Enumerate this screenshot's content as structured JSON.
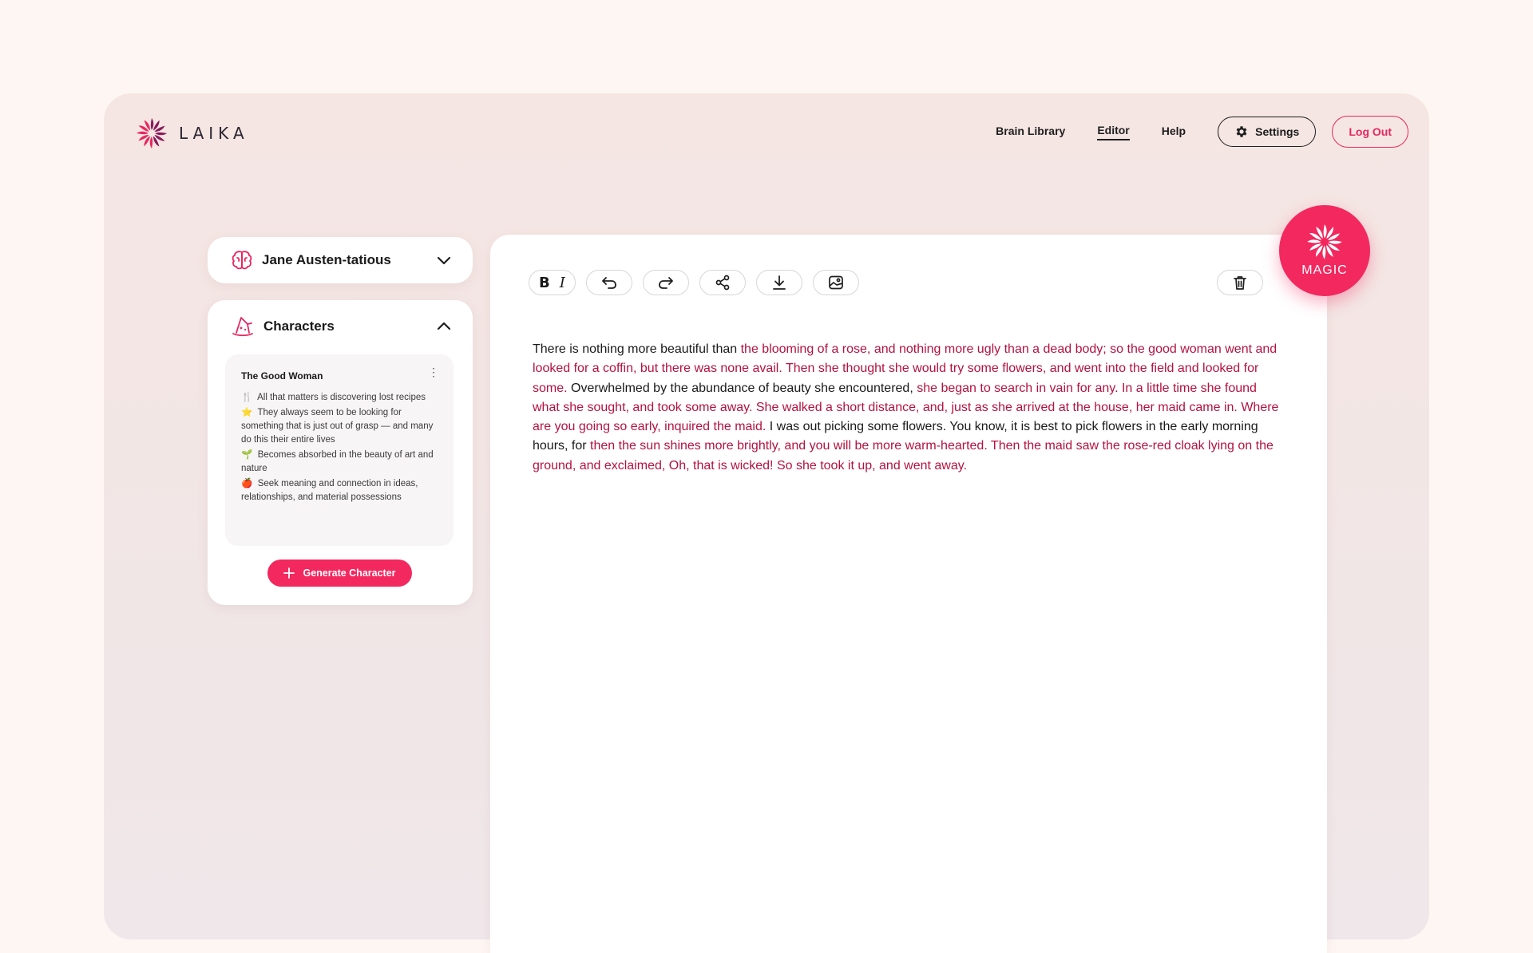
{
  "header": {
    "logo_text": "LAIKA",
    "nav": [
      "Brain Library",
      "Editor",
      "Help"
    ],
    "active_nav": "Editor",
    "settings_label": "Settings",
    "logout_label": "Log Out"
  },
  "brain": {
    "title": "Jane Austen-tatious",
    "icon": "brain-icon"
  },
  "characters": {
    "title": "Characters",
    "icon": "wizard-hat-icon",
    "items": [
      {
        "name": "The Good Woman",
        "traits": [
          {
            "emoji": "🍴",
            "text": "All that matters is discovering lost recipes"
          },
          {
            "emoji": "⭐",
            "text": "They always seem to be looking for something that is just out of grasp — and many do this their entire lives"
          },
          {
            "emoji": "🌱",
            "text": "Becomes absorbed in the beauty of art and nature"
          },
          {
            "emoji": "🍎",
            "text": "Seek meaning and connection in ideas, relationships, and material possessions"
          }
        ]
      }
    ],
    "generate_label": "Generate Character"
  },
  "editor": {
    "segments": [
      {
        "t": "There is nothing more beautiful than ",
        "h": false
      },
      {
        "t": "the blooming of a rose, and nothing more ugly than a dead body; so the good woman went and looked for a coffin, but there was none avail. Then she thought she would try some flowers, and went into the field and looked for some.",
        "h": true
      },
      {
        "t": " Overwhelmed by the abundance of beauty she encountered, ",
        "h": false
      },
      {
        "t": "she began to search in vain for any. In a little time she found what she sought, and took some away. She walked a short distance, and, just as she arrived at the house, her maid came in. Where are you going so early, inquired the maid.",
        "h": true
      },
      {
        "t": " I was out picking some flowers. You know, it is best to pick flowers in the early morning hours, for ",
        "h": false
      },
      {
        "t": "then the sun shines more brightly, and you will be more warm-hearted. Then the maid saw the rose-red cloak lying on the ground, and exclaimed, Oh, that is wicked! So she took it up, and went away.",
        "h": true
      }
    ]
  },
  "magic": {
    "label": "MAGIC"
  },
  "colors": {
    "accent": "#f2285f",
    "highlight_text": "#b4123f",
    "background": "#fdf6f2"
  }
}
